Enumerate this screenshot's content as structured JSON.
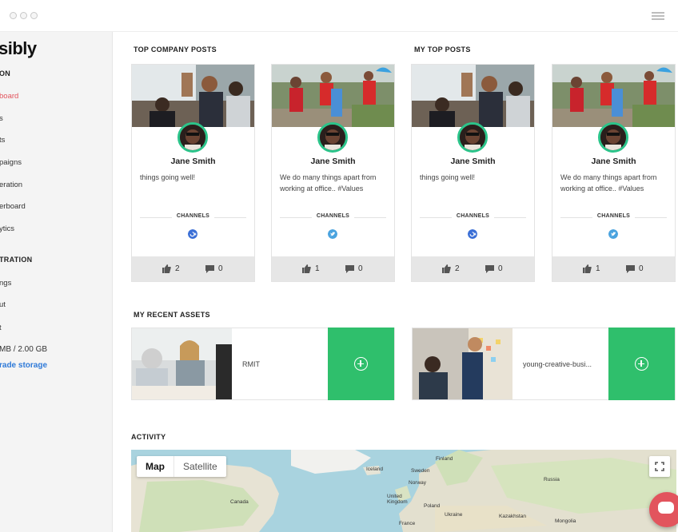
{
  "sidebar": {
    "brand": "sibly",
    "section_1": "ON",
    "items_1": [
      {
        "label": "board",
        "active": true
      },
      {
        "label": "s",
        "active": false
      },
      {
        "label": "ts",
        "active": false
      },
      {
        "label": "paigns",
        "active": false
      },
      {
        "label": "eration",
        "active": false
      },
      {
        "label": "erboard",
        "active": false
      },
      {
        "label": "ytics",
        "active": false
      }
    ],
    "section_2": "TRATION",
    "items_2": [
      {
        "label": "ngs"
      },
      {
        "label": "ut"
      }
    ],
    "stub": "t",
    "storage": "MB / 2.00 GB",
    "upgrade": "rade storage"
  },
  "sections": {
    "company_posts": "TOP COMPANY POSTS",
    "my_posts": "MY TOP POSTS",
    "assets": "MY RECENT ASSETS",
    "activity": "ACTIVITY"
  },
  "posts": [
    {
      "author": "Jane Smith",
      "text": "things going well!",
      "channels_label": "CHANNELS",
      "channel_icon": "google-plus-icon",
      "likes": "2",
      "comments": "0"
    },
    {
      "author": "Jane Smith",
      "text": "We do many things apart from working at office.. #Values",
      "channels_label": "CHANNELS",
      "channel_icon": "twitter-icon",
      "likes": "1",
      "comments": "0"
    },
    {
      "author": "Jane Smith",
      "text": "things going well!",
      "channels_label": "CHANNELS",
      "channel_icon": "google-plus-icon",
      "likes": "2",
      "comments": "0"
    },
    {
      "author": "Jane Smith",
      "text": "We do many things apart from working at office.. #Values",
      "channels_label": "CHANNELS",
      "channel_icon": "twitter-icon",
      "likes": "1",
      "comments": "0"
    }
  ],
  "assets": [
    {
      "name": "RMIT"
    },
    {
      "name": "young-creative-busi..."
    }
  ],
  "map": {
    "mode_map": "Map",
    "mode_satellite": "Satellite",
    "labels": [
      "Finland",
      "Iceland",
      "Sweden",
      "Norway",
      "Russia",
      "United Kingdom",
      "Poland",
      "Ukraine",
      "France",
      "Kazakhstan",
      "Mongolia",
      "Canada"
    ]
  },
  "colors": {
    "accent_red": "#e2545d",
    "add_green": "#2fbf6c",
    "link_blue": "#2f7ad8",
    "avatar_ring": "#2bc48a"
  }
}
